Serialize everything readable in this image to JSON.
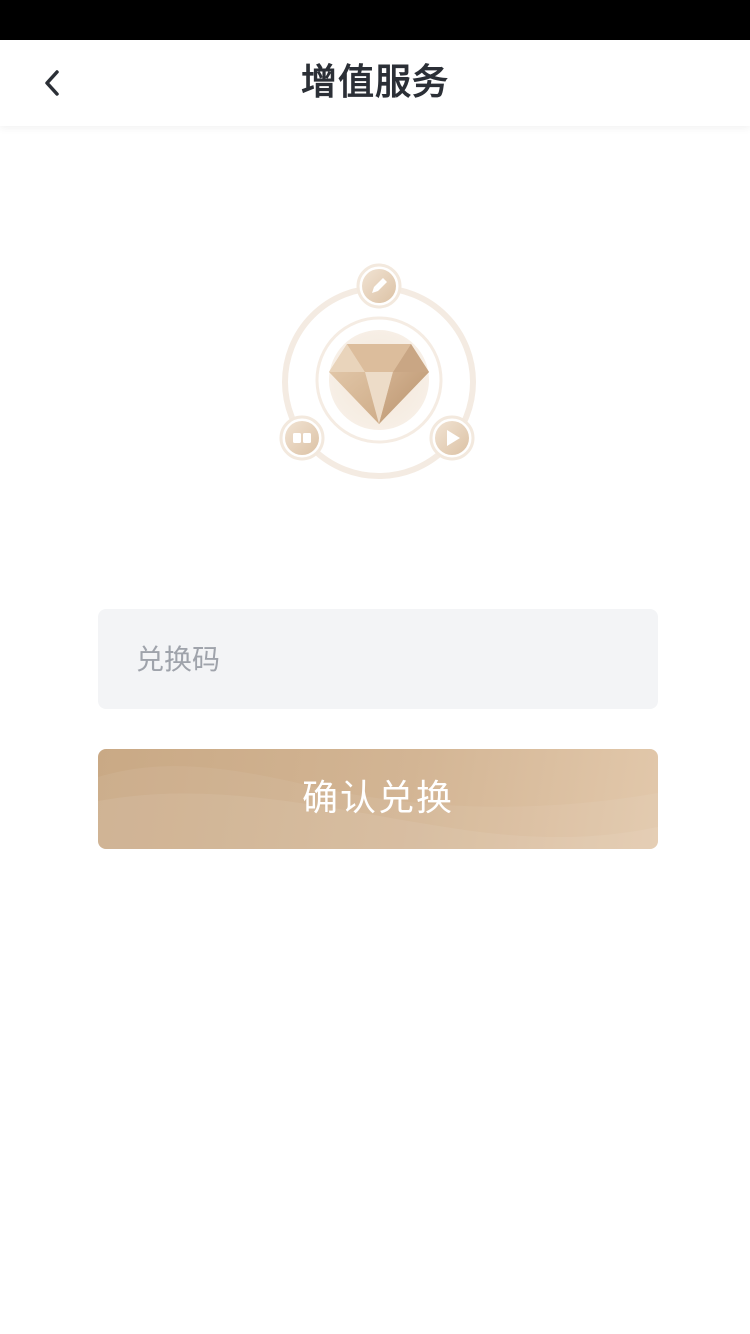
{
  "status_bar": {},
  "nav": {
    "back_icon": "chevron-left-icon",
    "title": "增值服务"
  },
  "hero": {
    "main_icon": "diamond-icon",
    "orbit_icons": [
      "pencil-icon",
      "book-icon",
      "play-icon"
    ]
  },
  "redeem": {
    "placeholder": "兑换码",
    "value": ""
  },
  "confirm": {
    "label": "确认兑换"
  },
  "colors": {
    "accent": "#c9a985",
    "accent_light": "#e2c8ab",
    "title_text": "#2b2f36",
    "input_bg": "#f3f4f6",
    "placeholder": "#9fa3ab"
  }
}
